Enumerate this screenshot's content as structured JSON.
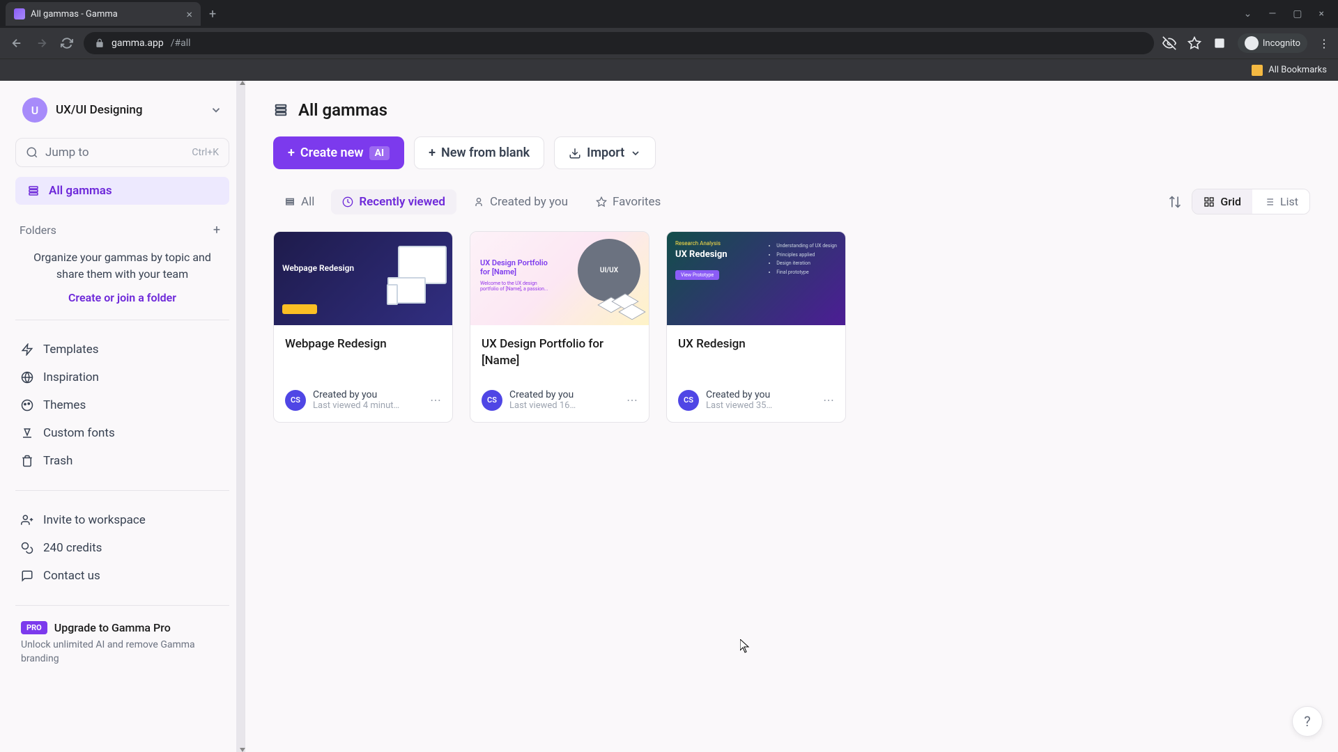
{
  "browser": {
    "tab_title": "All gammas - Gamma",
    "url_host": "gamma.app",
    "url_path": "/#all",
    "incognito_label": "Incognito",
    "bookmarks_label": "All Bookmarks"
  },
  "workspace": {
    "avatar_letter": "U",
    "name": "UX/UI Designing"
  },
  "sidebar": {
    "jump_label": "Jump to",
    "jump_shortcut": "Ctrl+K",
    "all_gammas": "All gammas",
    "folders_label": "Folders",
    "folders_empty_text": "Organize your gammas by topic and share them with your team",
    "folders_cta": "Create or join a folder",
    "links": {
      "templates": "Templates",
      "inspiration": "Inspiration",
      "themes": "Themes",
      "custom_fonts": "Custom fonts",
      "trash": "Trash",
      "invite": "Invite to workspace",
      "credits": "240 credits",
      "contact": "Contact us"
    },
    "pro": {
      "badge": "PRO",
      "title": "Upgrade to Gamma Pro",
      "subtitle": "Unlock unlimited AI and remove Gamma branding"
    }
  },
  "page": {
    "title": "All gammas",
    "create_label": "Create new",
    "create_badge": "AI",
    "new_blank": "New from blank",
    "import": "Import"
  },
  "filters": {
    "all": "All",
    "recent": "Recently viewed",
    "created": "Created by you",
    "favorites": "Favorites",
    "grid": "Grid",
    "list": "List"
  },
  "cards": [
    {
      "title": "Webpage Redesign",
      "avatar": "CS",
      "creator": "Created by you",
      "time": "Last viewed 4 minut…",
      "thumb_label": "Webpage Redesign"
    },
    {
      "title": "UX Design Portfolio for [Name]",
      "avatar": "CS",
      "creator": "Created by you",
      "time": "Last viewed 16…",
      "thumb_label": "UX Design Portfolio for [Name]",
      "thumb_circle": "UI/UX"
    },
    {
      "title": "UX Redesign",
      "avatar": "CS",
      "creator": "Created by you",
      "time": "Last viewed 35…",
      "thumb_label": "UX Redesign"
    }
  ],
  "help_label": "?"
}
